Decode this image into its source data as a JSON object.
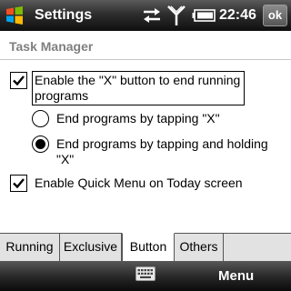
{
  "titlebar": {
    "app_title": "Settings",
    "clock": "22:46",
    "ok_label": "ok",
    "icons": [
      "windows-start-icon",
      "sync-arrows-icon",
      "signal-strength-icon",
      "battery-icon"
    ]
  },
  "header": {
    "title": "Task Manager"
  },
  "options": {
    "enable_x_button": {
      "label": "Enable the \"X\" button to end running programs",
      "checked": true
    },
    "end_by_tap": {
      "label": "End programs by tapping \"X\"",
      "selected": false
    },
    "end_by_tap_hold": {
      "label": "End programs by tapping and holding \"X\"",
      "selected": true
    },
    "enable_quick_menu": {
      "label": "Enable Quick Menu on Today screen",
      "checked": true
    }
  },
  "tabs": [
    {
      "label": "Running",
      "active": false
    },
    {
      "label": "Exclusive",
      "active": false
    },
    {
      "label": "Button",
      "active": true
    },
    {
      "label": "Others",
      "active": false
    }
  ],
  "softkeys": {
    "right_label": "Menu",
    "center_icon": "keyboard-icon"
  }
}
